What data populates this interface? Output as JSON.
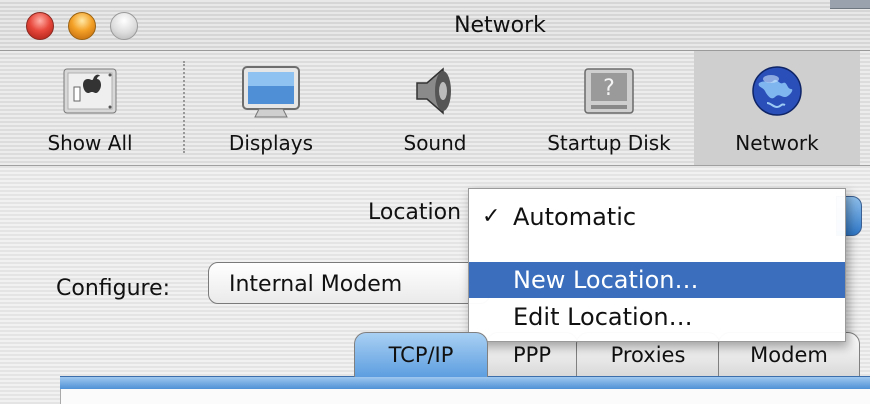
{
  "window": {
    "title": "Network"
  },
  "toolbar": {
    "items": [
      {
        "label": "Show All",
        "icon": "show-all-icon"
      },
      {
        "label": "Displays",
        "icon": "displays-icon"
      },
      {
        "label": "Sound",
        "icon": "speaker-icon"
      },
      {
        "label": "Startup Disk",
        "icon": "hard-disk-icon"
      },
      {
        "label": "Network",
        "icon": "globe-icon",
        "selected": true
      }
    ]
  },
  "location": {
    "label": "Location",
    "menu": {
      "items": [
        {
          "label": "Automatic",
          "checked": true,
          "check_glyph": "✓"
        },
        {
          "label": "New Location…",
          "highlighted": true
        },
        {
          "label": "Edit Location…"
        }
      ]
    }
  },
  "configure": {
    "label": "Configure:",
    "value": "Internal Modem"
  },
  "tabs": [
    {
      "label": "TCP/IP",
      "selected": true
    },
    {
      "label": "PPP"
    },
    {
      "label": "Proxies"
    },
    {
      "label": "Modem"
    }
  ],
  "colors": {
    "selection": "#3b6fbd",
    "aqua_blue": "#5d9ee0"
  }
}
